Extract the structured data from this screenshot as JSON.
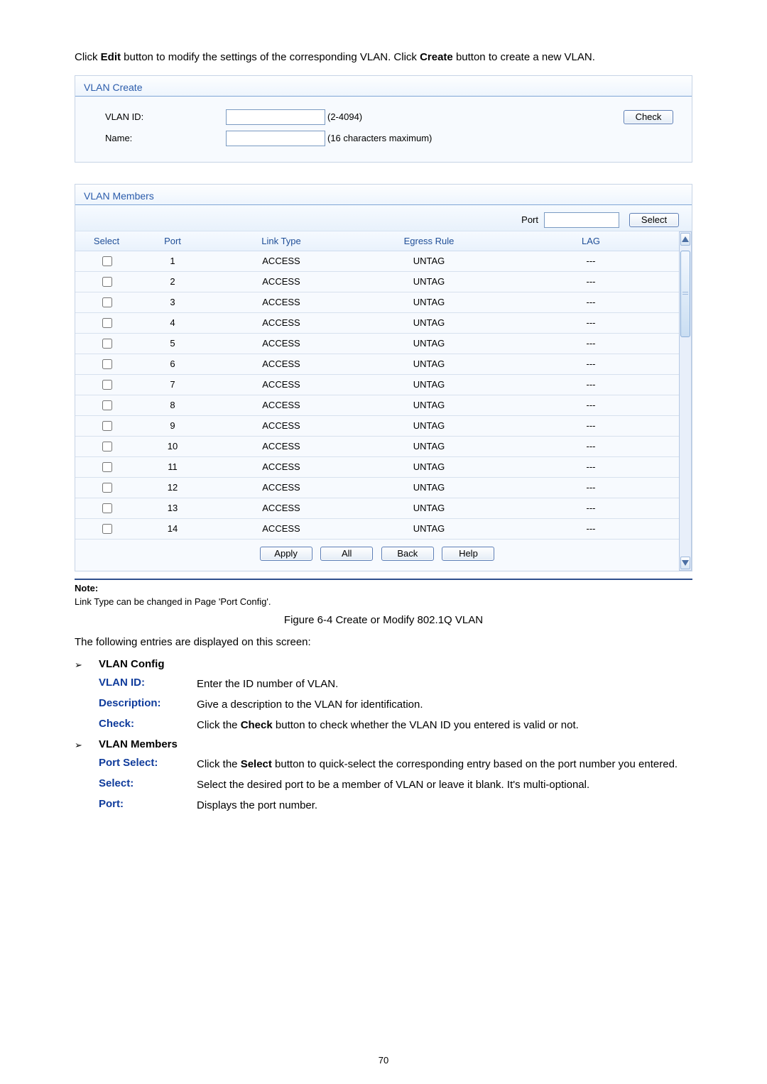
{
  "intro": {
    "p1a": "Click ",
    "edit": "Edit",
    "p1b": " button to modify the settings of the corresponding VLAN. Click ",
    "create": "Create",
    "p1c": " button to create a new VLAN."
  },
  "vlan_create": {
    "title": "VLAN Create",
    "vlan_id_label": "VLAN ID:",
    "vlan_id_hint": "(2-4094)",
    "check_btn": "Check",
    "name_label": "Name:",
    "name_hint": "(16 characters maximum)"
  },
  "vlan_members": {
    "title": "VLAN Members",
    "port_label": "Port",
    "select_btn": "Select",
    "columns": {
      "select": "Select",
      "port": "Port",
      "link_type": "Link Type",
      "egress_rule": "Egress Rule",
      "lag": "LAG"
    },
    "rows": [
      {
        "port": "1",
        "link": "ACCESS",
        "egress": "UNTAG",
        "lag": "---"
      },
      {
        "port": "2",
        "link": "ACCESS",
        "egress": "UNTAG",
        "lag": "---"
      },
      {
        "port": "3",
        "link": "ACCESS",
        "egress": "UNTAG",
        "lag": "---"
      },
      {
        "port": "4",
        "link": "ACCESS",
        "egress": "UNTAG",
        "lag": "---"
      },
      {
        "port": "5",
        "link": "ACCESS",
        "egress": "UNTAG",
        "lag": "---"
      },
      {
        "port": "6",
        "link": "ACCESS",
        "egress": "UNTAG",
        "lag": "---"
      },
      {
        "port": "7",
        "link": "ACCESS",
        "egress": "UNTAG",
        "lag": "---"
      },
      {
        "port": "8",
        "link": "ACCESS",
        "egress": "UNTAG",
        "lag": "---"
      },
      {
        "port": "9",
        "link": "ACCESS",
        "egress": "UNTAG",
        "lag": "---"
      },
      {
        "port": "10",
        "link": "ACCESS",
        "egress": "UNTAG",
        "lag": "---"
      },
      {
        "port": "11",
        "link": "ACCESS",
        "egress": "UNTAG",
        "lag": "---"
      },
      {
        "port": "12",
        "link": "ACCESS",
        "egress": "UNTAG",
        "lag": "---"
      },
      {
        "port": "13",
        "link": "ACCESS",
        "egress": "UNTAG",
        "lag": "---"
      },
      {
        "port": "14",
        "link": "ACCESS",
        "egress": "UNTAG",
        "lag": "---"
      }
    ],
    "buttons": {
      "apply": "Apply",
      "all": "All",
      "back": "Back",
      "help": "Help"
    }
  },
  "note": {
    "label": "Note:",
    "text": "Link Type can be changed in Page 'Port Config'."
  },
  "figure_caption": "Figure 6-4 Create or Modify 802.1Q VLAN",
  "desc_intro": "The following entries are displayed on this screen:",
  "section1": {
    "title": "VLAN Config",
    "rows": [
      {
        "term": "VLAN ID:",
        "desc_parts": [
          "Enter the ID number of VLAN."
        ]
      },
      {
        "term": "Description:",
        "desc_parts": [
          "Give a description to the VLAN for identification."
        ]
      },
      {
        "term": "Check:",
        "desc_parts": [
          "Click the ",
          "Check",
          " button to check whether the VLAN ID you entered is valid or not."
        ]
      }
    ]
  },
  "section2": {
    "title": "VLAN Members",
    "rows": [
      {
        "term": "Port Select:",
        "desc_parts": [
          "Click the ",
          "Select",
          " button to quick-select the corresponding entry based on the port number you entered."
        ]
      },
      {
        "term": "Select:",
        "desc_parts": [
          "Select the desired port to be a member of VLAN or leave it blank. It's multi-optional."
        ]
      },
      {
        "term": "Port:",
        "desc_parts": [
          "Displays the port number."
        ]
      }
    ]
  },
  "page_number": "70"
}
